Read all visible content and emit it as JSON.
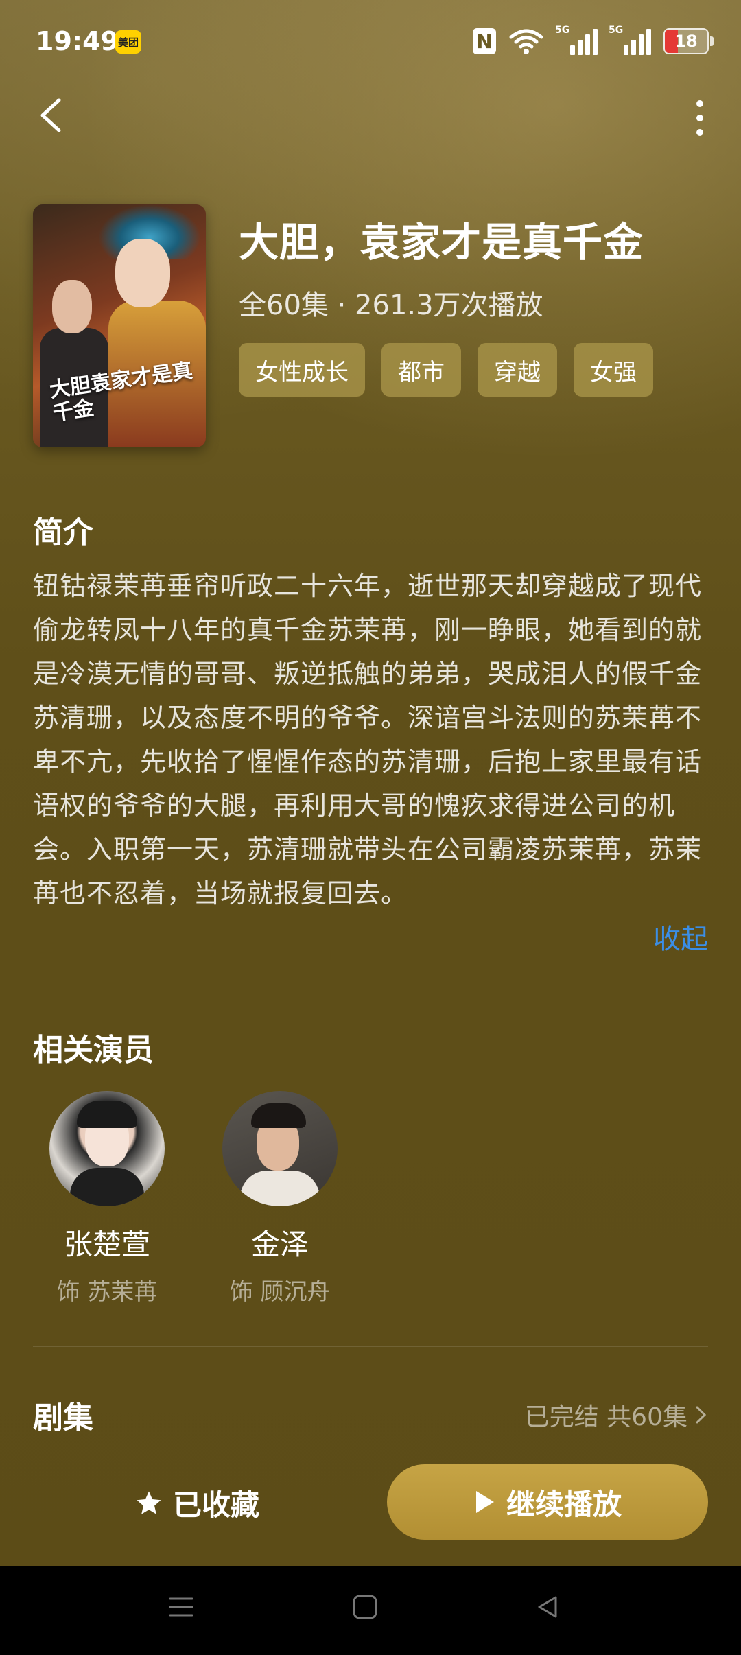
{
  "status_bar": {
    "time": "19:49",
    "app_badge": "美团",
    "nfc": "N",
    "signal_label_1": "5G",
    "signal_label_2": "5G",
    "battery": "18",
    "battery_color": "#e53935"
  },
  "nav": {
    "back_icon": "chevron-left-icon",
    "more_icon": "more-vertical-icon"
  },
  "drama": {
    "poster_title": "大胆袁家才是真千金",
    "title": "大胆，袁家才是真千金",
    "meta": "全60集 · 261.3万次播放",
    "tags": [
      "女性成长",
      "都市",
      "穿越",
      "女强"
    ]
  },
  "synopsis": {
    "heading": "简介",
    "text": "钮钴禄茉苒垂帘听政二十六年，逝世那天却穿越成了现代偷龙转凤十八年的真千金苏茉苒，刚一睁眼，她看到的就是冷漠无情的哥哥、叛逆抵触的弟弟，哭成泪人的假千金苏清珊，以及态度不明的爷爷。深谙宫斗法则的苏茉苒不卑不亢，先收拾了惺惺作态的苏清珊，后抱上家里最有话语权的爷爷的大腿，再利用大哥的愧疚求得进公司的机会。入职第一天，苏清珊就带头在公司霸凌苏茉苒，苏茉苒也不忍着，当场就报复回去。",
    "collapse_label": "收起"
  },
  "cast": {
    "heading": "相关演员",
    "actors": [
      {
        "name": "张楚萱",
        "role": "饰 苏茉苒"
      },
      {
        "name": "金泽",
        "role": "饰 顾沉舟"
      }
    ]
  },
  "episodes": {
    "heading": "剧集",
    "status": "已完结 共60集"
  },
  "actions": {
    "favorite_label": "已收藏",
    "play_label": "继续播放",
    "accent_color": "#c6a445"
  },
  "system_nav": {
    "menu_icon": "menu-icon",
    "home_icon": "home-square-icon",
    "back_icon": "triangle-back-icon"
  }
}
